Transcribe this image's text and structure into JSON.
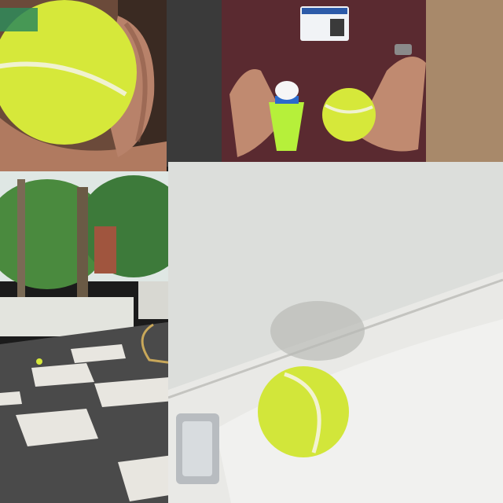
{
  "collage": {
    "panels": [
      {
        "id": "p1",
        "subject": "hand-holding-tennis-ball"
      },
      {
        "id": "p2",
        "subject": "person-holding-shuttlecock-and-tennis-ball"
      },
      {
        "id": "p3",
        "subject": "garden-courtyard-with-tiled-floor"
      },
      {
        "id": "p4",
        "subject": "tennis-ball-on-sink-countertop"
      }
    ]
  },
  "colors": {
    "tennis_ball": "#d6e83a",
    "ball_seam": "#f2f2d0",
    "dress": "#5a2a30",
    "skin": "#c08a70",
    "floor_dark": "#4a4a4a",
    "tile_light": "#e8e6e0",
    "wall": "#dcdedb",
    "foliage": "#3d7a3a",
    "counter": "#e6e6e2"
  }
}
